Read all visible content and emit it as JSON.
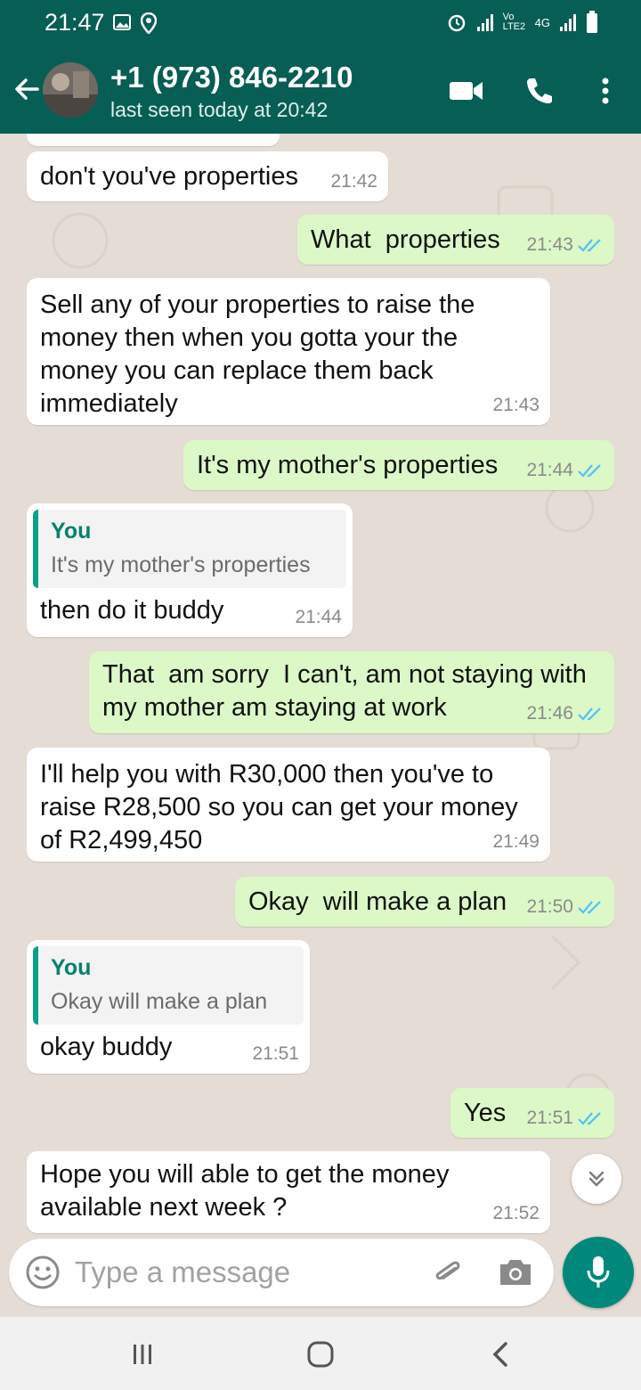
{
  "status_bar": {
    "time": "21:47",
    "network_label": "Vo LTE2",
    "network_type": "4G"
  },
  "header": {
    "contact_name": "+1 (973) 846-2210",
    "last_seen": "last seen today at 20:42",
    "accent_color": "#075e54"
  },
  "messages": [
    {
      "direction": "incoming",
      "text": "don't you've properties",
      "time": "21:42"
    },
    {
      "direction": "outgoing",
      "text": "What  properties",
      "time": "21:43",
      "read": true
    },
    {
      "direction": "incoming",
      "text": "Sell any of your properties to raise the\nmoney then when you gotta your the\nmoney you can replace them back\nimmediately",
      "time": "21:43"
    },
    {
      "direction": "outgoing",
      "text": "It's my mother's properties",
      "time": "21:44",
      "read": true
    },
    {
      "direction": "incoming",
      "quote_author": "You",
      "quote_text": "It's my mother's properties",
      "text": "then do it buddy",
      "time": "21:44"
    },
    {
      "direction": "outgoing",
      "text": "That  am sorry  I can't, am not staying with\nmy mother am staying at work",
      "time": "21:46",
      "read": true
    },
    {
      "direction": "incoming",
      "text": "I'll help you with R30,000 then you've to\nraise R28,500 so you can get your money\nof R2,499,450",
      "time": "21:49"
    },
    {
      "direction": "outgoing",
      "text": "Okay  will make a plan",
      "time": "21:50",
      "read": true
    },
    {
      "direction": "incoming",
      "quote_author": "You",
      "quote_text": "Okay  will make a plan",
      "text": "okay buddy",
      "time": "21:51"
    },
    {
      "direction": "outgoing",
      "text": "Yes",
      "time": "21:51",
      "read": true
    },
    {
      "direction": "incoming",
      "text": "Hope you will able to get the money\navailable next week ?",
      "time": "21:52"
    }
  ],
  "input": {
    "placeholder": "Type a message"
  },
  "icons": {
    "back": "back-arrow-icon",
    "video_call": "video-camera-icon",
    "voice_call": "phone-icon",
    "menu": "more-vertical-icon",
    "emoji": "emoji-icon",
    "attach": "paperclip-icon",
    "camera": "camera-icon",
    "mic": "microphone-icon",
    "scroll_down": "double-chevron-down-icon"
  }
}
